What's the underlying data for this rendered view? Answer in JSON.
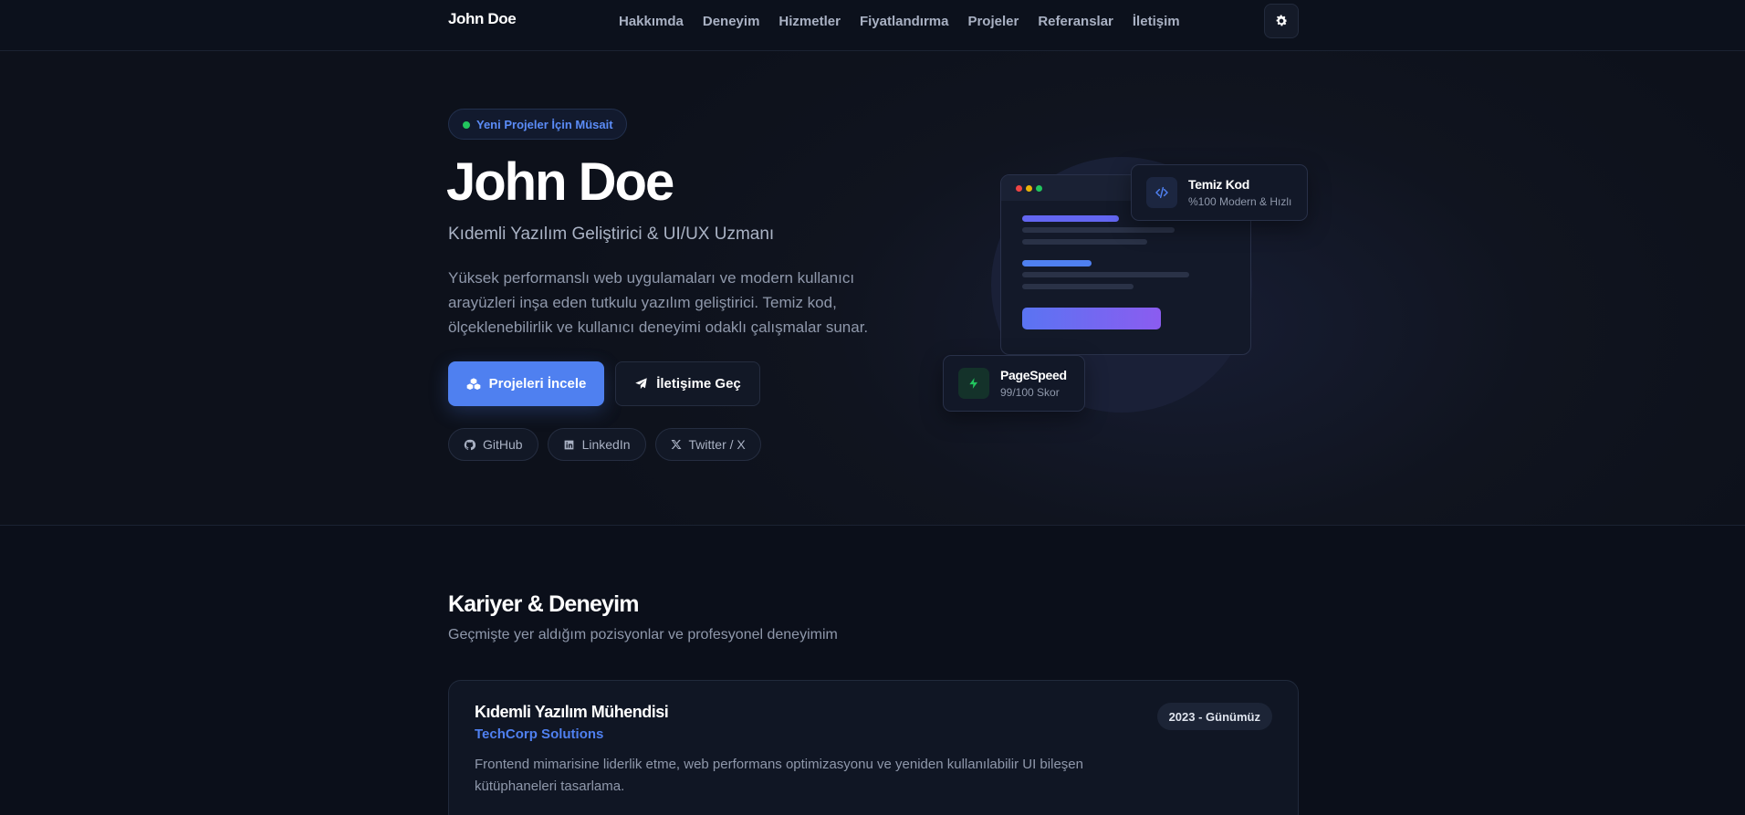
{
  "nav": {
    "brand": "John Doe",
    "links": [
      "Hakkımda",
      "Deneyim",
      "Hizmetler",
      "Fiyatlandırma",
      "Projeler",
      "Referanslar",
      "İletişim"
    ],
    "theme_icon": "gear-icon"
  },
  "hero": {
    "badge": "Yeni Projeler İçin Müsait",
    "title": "John Doe",
    "subtitle": "Kıdemli Yazılım Geliştirici & UI/UX Uzmanı",
    "description": "Yüksek performanslı web uygulamaları ve modern kullanıcı arayüzleri inşa eden tutkulu yazılım geliştirici. Temiz kod, ölçeklenebilirlik ve kullanıcı deneyimi odaklı çalışmalar sunar.",
    "primary_button": "Projeleri İncele",
    "secondary_button": "İletişime Geç",
    "socials": [
      "GitHub",
      "LinkedIn",
      "Twitter / X"
    ]
  },
  "cards": {
    "clean_code": {
      "title": "Temiz Kod",
      "subtitle": "%100 Modern & Hızlı"
    },
    "pagespeed": {
      "title": "PageSpeed",
      "subtitle": "99/100 Skor"
    }
  },
  "experience": {
    "title": "Kariyer & Deneyim",
    "subtitle": "Geçmişte yer aldığım pozisyonlar ve profesyonel deneyimim",
    "items": [
      {
        "role": "Kıdemli Yazılım Mühendisi",
        "company": "TechCorp Solutions",
        "date": "2023 - Günümüz",
        "description": "Frontend mimarisine liderlik etme, web performans optimizasyonu ve yeniden kullanılabilir UI bileşen kütüphaneleri tasarlama."
      }
    ]
  },
  "colors": {
    "accent": "#4f80f0",
    "background": "#0b0f1a",
    "status_green": "#22c55e",
    "gradient_end": "#8b5cf0"
  }
}
